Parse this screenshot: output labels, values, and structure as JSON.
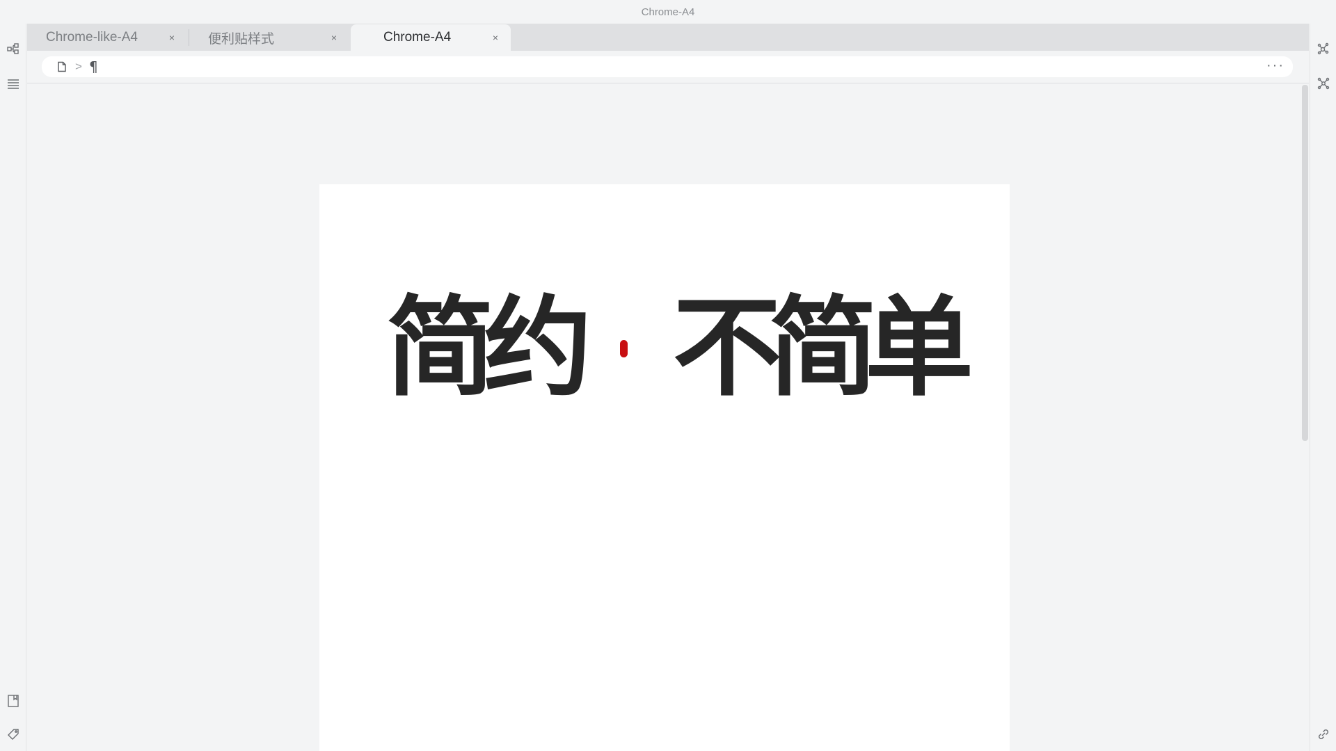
{
  "window": {
    "title": "Chrome-A4"
  },
  "tabs": [
    {
      "label": "Chrome-like-A4",
      "close": "×"
    },
    {
      "label": "便利贴样式",
      "close": "×"
    },
    {
      "label": "Chrome-A4",
      "close": "×"
    }
  ],
  "active_tab_index": 2,
  "breadcrumb": {
    "separator": ">",
    "paragraph_symbol": "¶",
    "more": "···"
  },
  "left_rail_icons": [
    "outline-tree-icon",
    "list-icon",
    "bookmark-icon",
    "tag-icon"
  ],
  "right_rail_icons": [
    "graph-icon",
    "global-graph-icon",
    "link-icon"
  ],
  "document": {
    "headline_chars": [
      "简",
      "约",
      "不",
      "简",
      "单"
    ],
    "dot_color": "#c80f12",
    "text_color": "#262626"
  }
}
